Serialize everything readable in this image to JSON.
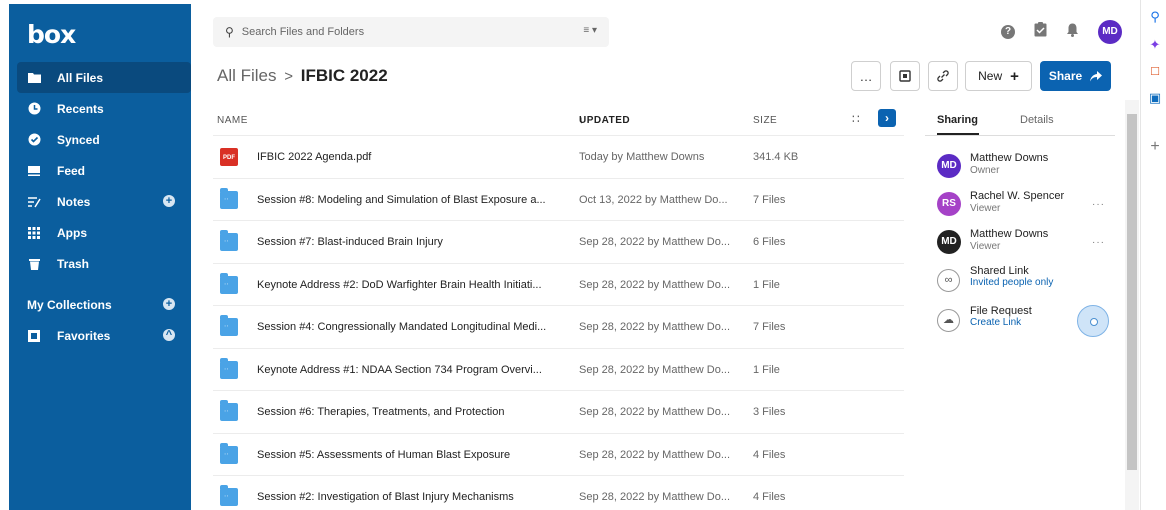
{
  "app": {
    "logo": "box"
  },
  "sidebar": {
    "items": [
      {
        "label": "All Files",
        "icon": "folder-icon",
        "active": true
      },
      {
        "label": "Recents",
        "icon": "clock-icon"
      },
      {
        "label": "Synced",
        "icon": "check-circle-icon"
      },
      {
        "label": "Feed",
        "icon": "feed-icon"
      },
      {
        "label": "Notes",
        "icon": "notes-icon",
        "add": "+"
      },
      {
        "label": "Apps",
        "icon": "apps-grid-icon"
      },
      {
        "label": "Trash",
        "icon": "trash-icon"
      }
    ],
    "collections": {
      "label": "My Collections",
      "add": "+"
    },
    "favorites": {
      "label": "Favorites",
      "toggle": "^"
    }
  },
  "search": {
    "placeholder": "Search Files and Folders",
    "filter_icon": "filter-icon"
  },
  "topbar": {
    "avatar": "MD"
  },
  "header": {
    "root": "All Files",
    "separator": ">",
    "current": "IFBIC 2022",
    "more": "…",
    "new_label": "New",
    "new_plus": "+",
    "share_label": "Share"
  },
  "table": {
    "columns": {
      "name": "NAME",
      "updated": "UPDATED",
      "sort_arrow": "↓",
      "size": "SIZE"
    },
    "rows": [
      {
        "type": "pdf",
        "name": "IFBIC 2022 Agenda.pdf",
        "updated": "Today by Matthew Downs",
        "size": "341.4 KB"
      },
      {
        "type": "folder",
        "name": "Session #8: Modeling and Simulation of Blast Exposure a...",
        "updated": "Oct 13, 2022 by Matthew Do...",
        "size": "7 Files"
      },
      {
        "type": "folder",
        "name": "Session #7: Blast-induced Brain Injury",
        "updated": "Sep 28, 2022 by Matthew Do...",
        "size": "6 Files"
      },
      {
        "type": "folder",
        "name": "Keynote Address #2: DoD Warfighter Brain Health Initiati...",
        "updated": "Sep 28, 2022 by Matthew Do...",
        "size": "1 File"
      },
      {
        "type": "folder",
        "name": "Session #4: Congressionally Mandated Longitudinal Medi...",
        "updated": "Sep 28, 2022 by Matthew Do...",
        "size": "7 Files"
      },
      {
        "type": "folder",
        "name": "Keynote Address #1: NDAA Section 734 Program Overvi...",
        "updated": "Sep 28, 2022 by Matthew Do...",
        "size": "1 File"
      },
      {
        "type": "folder",
        "name": "Session #6: Therapies, Treatments, and Protection",
        "updated": "Sep 28, 2022 by Matthew Do...",
        "size": "3 Files"
      },
      {
        "type": "folder",
        "name": "Session #5: Assessments of Human Blast Exposure",
        "updated": "Sep 28, 2022 by Matthew Do...",
        "size": "4 Files"
      },
      {
        "type": "folder",
        "name": "Session #2: Investigation of Blast Injury Mechanisms",
        "updated": "Sep 28, 2022 by Matthew Do...",
        "size": "4 Files"
      }
    ]
  },
  "panel": {
    "tabs": [
      "Sharing",
      "Details"
    ],
    "people": [
      {
        "initials": "MD",
        "name": "Matthew Downs",
        "role": "Owner",
        "color": "#5b2bc4",
        "more": ""
      },
      {
        "initials": "RS",
        "name": "Rachel W. Spencer",
        "role": "Viewer",
        "color": "#a542c7",
        "more": "···"
      },
      {
        "initials": "MD",
        "name": "Matthew Downs",
        "role": "Viewer",
        "color": "#222222",
        "more": "···"
      }
    ],
    "shared_link": {
      "title": "Shared Link",
      "sub": "Invited people only"
    },
    "file_request": {
      "title": "File Request",
      "sub": "Create Link"
    }
  }
}
